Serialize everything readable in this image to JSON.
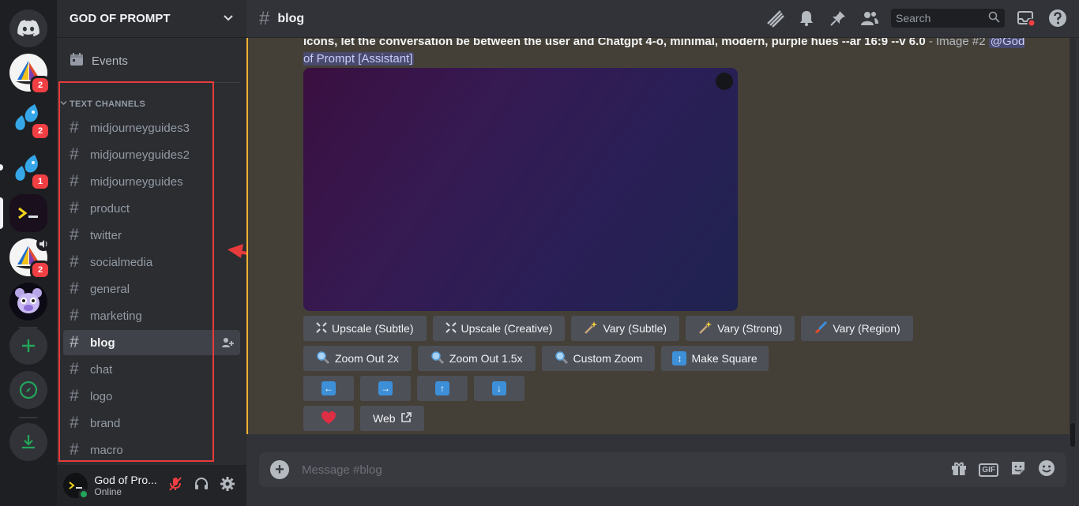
{
  "guild": {
    "name": "GOD OF PROMPT"
  },
  "servers": [
    {
      "name": "discord-home-icon",
      "badge": ""
    },
    {
      "name": "sailboat-server",
      "badge": "2"
    },
    {
      "name": "droplets-server-1",
      "badge": "2"
    },
    {
      "name": "droplets-server-2",
      "badge": "1"
    },
    {
      "name": "terminal-server",
      "badge": ""
    },
    {
      "name": "sailboat-server-2",
      "badge": "2"
    },
    {
      "name": "bear-server",
      "badge": ""
    }
  ],
  "sidebar": {
    "events_label": "Events",
    "category_label": "TEXT CHANNELS",
    "channels": [
      "midjourneyguides3",
      "midjourneyguides2",
      "midjourneyguides",
      "product",
      "twitter",
      "socialmedia",
      "general",
      "marketing",
      "blog",
      "chat",
      "logo",
      "brand",
      "macro"
    ],
    "active_channel": "blog"
  },
  "user": {
    "name": "God of Pro...",
    "status": "Online"
  },
  "header": {
    "channel": "blog",
    "search_placeholder": "Search"
  },
  "message": {
    "prompt_text": "icons, let the conversation be between the user and Chatgpt 4-o, minimal, modern, purple hues --ar 16:9 --v 6.0",
    "image_label": " - Image #2 ",
    "mention": "@God of Prompt [Assistant]"
  },
  "buttons": {
    "row1": [
      "Upscale (Subtle)",
      "Upscale (Creative)",
      "Vary (Subtle)",
      "Vary (Strong)",
      "Vary (Region)"
    ],
    "row2": [
      "Zoom Out 2x",
      "Zoom Out 1.5x",
      "Custom Zoom",
      "Make Square"
    ],
    "row3_icons": [
      "arrow-left-icon",
      "arrow-right-icon",
      "arrow-up-icon",
      "arrow-down-icon"
    ],
    "web_label": "Web"
  },
  "composer": {
    "placeholder": "Message #blog"
  },
  "colors": {
    "accent_red": "#f23f43",
    "highlight": "#f0b232",
    "annotation_red": "#e83b3b"
  }
}
